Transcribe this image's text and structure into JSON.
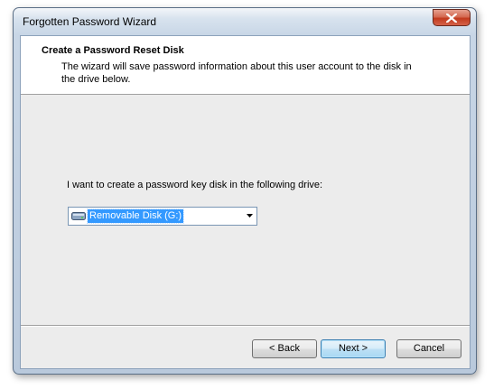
{
  "window": {
    "title": "Forgotten Password Wizard",
    "close_icon": "close-icon"
  },
  "header": {
    "title": "Create a Password Reset Disk",
    "description": "The wizard will save password information about this user account to the disk in the drive below."
  },
  "main": {
    "prompt": "I want to create a password key disk in the following drive:",
    "drive_select": {
      "selected": "Removable Disk (G:)",
      "icon": "removable-disk-icon"
    }
  },
  "buttons": {
    "back": "< Back",
    "next": "Next >",
    "cancel": "Cancel"
  },
  "colors": {
    "selection": "#3399ff",
    "close_button": "#c23a1d",
    "default_button_border": "#3c7fb1"
  }
}
